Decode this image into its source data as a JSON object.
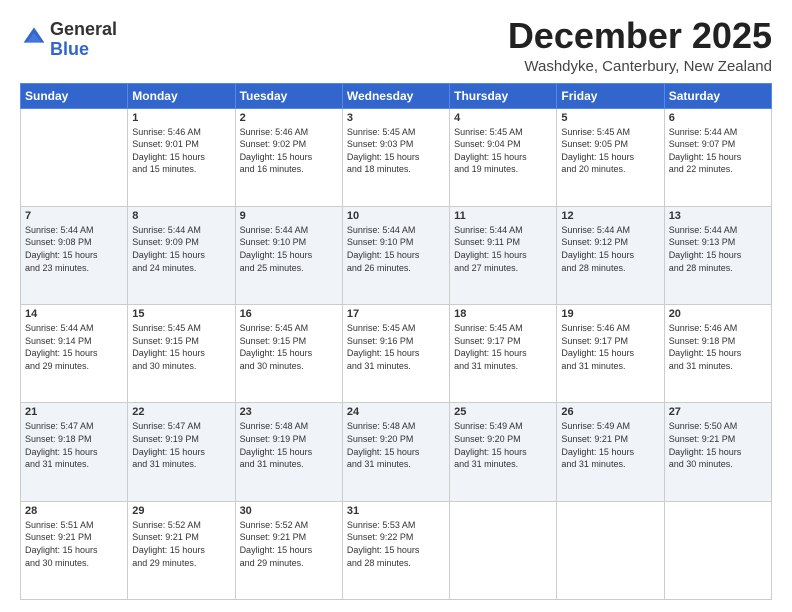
{
  "logo": {
    "general": "General",
    "blue": "Blue"
  },
  "title": "December 2025",
  "location": "Washdyke, Canterbury, New Zealand",
  "days_of_week": [
    "Sunday",
    "Monday",
    "Tuesday",
    "Wednesday",
    "Thursday",
    "Friday",
    "Saturday"
  ],
  "weeks": [
    [
      {
        "day": "",
        "info": ""
      },
      {
        "day": "1",
        "info": "Sunrise: 5:46 AM\nSunset: 9:01 PM\nDaylight: 15 hours\nand 15 minutes."
      },
      {
        "day": "2",
        "info": "Sunrise: 5:46 AM\nSunset: 9:02 PM\nDaylight: 15 hours\nand 16 minutes."
      },
      {
        "day": "3",
        "info": "Sunrise: 5:45 AM\nSunset: 9:03 PM\nDaylight: 15 hours\nand 18 minutes."
      },
      {
        "day": "4",
        "info": "Sunrise: 5:45 AM\nSunset: 9:04 PM\nDaylight: 15 hours\nand 19 minutes."
      },
      {
        "day": "5",
        "info": "Sunrise: 5:45 AM\nSunset: 9:05 PM\nDaylight: 15 hours\nand 20 minutes."
      },
      {
        "day": "6",
        "info": "Sunrise: 5:44 AM\nSunset: 9:07 PM\nDaylight: 15 hours\nand 22 minutes."
      }
    ],
    [
      {
        "day": "7",
        "info": "Sunrise: 5:44 AM\nSunset: 9:08 PM\nDaylight: 15 hours\nand 23 minutes."
      },
      {
        "day": "8",
        "info": "Sunrise: 5:44 AM\nSunset: 9:09 PM\nDaylight: 15 hours\nand 24 minutes."
      },
      {
        "day": "9",
        "info": "Sunrise: 5:44 AM\nSunset: 9:10 PM\nDaylight: 15 hours\nand 25 minutes."
      },
      {
        "day": "10",
        "info": "Sunrise: 5:44 AM\nSunset: 9:10 PM\nDaylight: 15 hours\nand 26 minutes."
      },
      {
        "day": "11",
        "info": "Sunrise: 5:44 AM\nSunset: 9:11 PM\nDaylight: 15 hours\nand 27 minutes."
      },
      {
        "day": "12",
        "info": "Sunrise: 5:44 AM\nSunset: 9:12 PM\nDaylight: 15 hours\nand 28 minutes."
      },
      {
        "day": "13",
        "info": "Sunrise: 5:44 AM\nSunset: 9:13 PM\nDaylight: 15 hours\nand 28 minutes."
      }
    ],
    [
      {
        "day": "14",
        "info": "Sunrise: 5:44 AM\nSunset: 9:14 PM\nDaylight: 15 hours\nand 29 minutes."
      },
      {
        "day": "15",
        "info": "Sunrise: 5:45 AM\nSunset: 9:15 PM\nDaylight: 15 hours\nand 30 minutes."
      },
      {
        "day": "16",
        "info": "Sunrise: 5:45 AM\nSunset: 9:15 PM\nDaylight: 15 hours\nand 30 minutes."
      },
      {
        "day": "17",
        "info": "Sunrise: 5:45 AM\nSunset: 9:16 PM\nDaylight: 15 hours\nand 31 minutes."
      },
      {
        "day": "18",
        "info": "Sunrise: 5:45 AM\nSunset: 9:17 PM\nDaylight: 15 hours\nand 31 minutes."
      },
      {
        "day": "19",
        "info": "Sunrise: 5:46 AM\nSunset: 9:17 PM\nDaylight: 15 hours\nand 31 minutes."
      },
      {
        "day": "20",
        "info": "Sunrise: 5:46 AM\nSunset: 9:18 PM\nDaylight: 15 hours\nand 31 minutes."
      }
    ],
    [
      {
        "day": "21",
        "info": "Sunrise: 5:47 AM\nSunset: 9:18 PM\nDaylight: 15 hours\nand 31 minutes."
      },
      {
        "day": "22",
        "info": "Sunrise: 5:47 AM\nSunset: 9:19 PM\nDaylight: 15 hours\nand 31 minutes."
      },
      {
        "day": "23",
        "info": "Sunrise: 5:48 AM\nSunset: 9:19 PM\nDaylight: 15 hours\nand 31 minutes."
      },
      {
        "day": "24",
        "info": "Sunrise: 5:48 AM\nSunset: 9:20 PM\nDaylight: 15 hours\nand 31 minutes."
      },
      {
        "day": "25",
        "info": "Sunrise: 5:49 AM\nSunset: 9:20 PM\nDaylight: 15 hours\nand 31 minutes."
      },
      {
        "day": "26",
        "info": "Sunrise: 5:49 AM\nSunset: 9:21 PM\nDaylight: 15 hours\nand 31 minutes."
      },
      {
        "day": "27",
        "info": "Sunrise: 5:50 AM\nSunset: 9:21 PM\nDaylight: 15 hours\nand 30 minutes."
      }
    ],
    [
      {
        "day": "28",
        "info": "Sunrise: 5:51 AM\nSunset: 9:21 PM\nDaylight: 15 hours\nand 30 minutes."
      },
      {
        "day": "29",
        "info": "Sunrise: 5:52 AM\nSunset: 9:21 PM\nDaylight: 15 hours\nand 29 minutes."
      },
      {
        "day": "30",
        "info": "Sunrise: 5:52 AM\nSunset: 9:21 PM\nDaylight: 15 hours\nand 29 minutes."
      },
      {
        "day": "31",
        "info": "Sunrise: 5:53 AM\nSunset: 9:22 PM\nDaylight: 15 hours\nand 28 minutes."
      },
      {
        "day": "",
        "info": ""
      },
      {
        "day": "",
        "info": ""
      },
      {
        "day": "",
        "info": ""
      }
    ]
  ]
}
